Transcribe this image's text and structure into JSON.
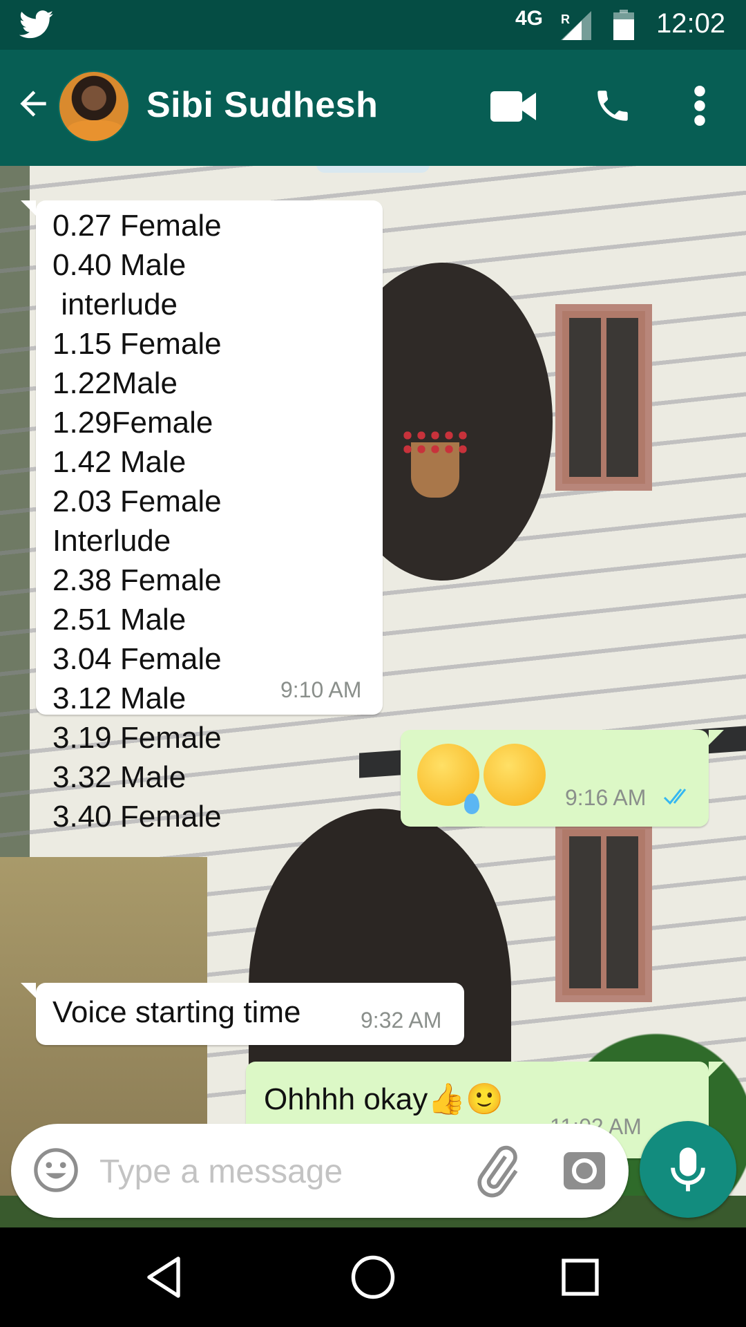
{
  "status_bar": {
    "network": "4G",
    "roaming": "R",
    "time": "12:02",
    "icons": [
      "twitter-icon",
      "signal-icon",
      "battery-icon"
    ]
  },
  "header": {
    "contact_name": "Sibi Sudhesh",
    "icons": [
      "back-arrow-icon",
      "video-call-icon",
      "phone-icon",
      "more-vert-icon"
    ]
  },
  "messages": [
    {
      "direction": "incoming",
      "text": "0.27 Female\n0.40 Male\n interlude\n1.15 Female\n1.22Male\n1.29Female\n1.42 Male\n2.03 Female\nInterlude\n2.38 Female\n2.51 Male\n3.04 Female\n3.12 Male\n3.19 Female\n3.32 Male\n3.40 Female",
      "time": "9:10 AM"
    },
    {
      "direction": "outgoing",
      "text": "😢🤔",
      "time": "9:16 AM",
      "status": "read"
    },
    {
      "direction": "incoming",
      "text": "Voice starting time",
      "time": "9:32 AM"
    },
    {
      "direction": "outgoing",
      "text": "Ohhhh okay👍🙂",
      "time": "11:02 AM",
      "status": "read"
    }
  ],
  "composer": {
    "placeholder": "Type a message",
    "icons": [
      "emoji-icon",
      "attach-icon",
      "camera-icon",
      "mic-icon"
    ]
  },
  "colors": {
    "status_bar": "#054d44",
    "app_bar": "#075e54",
    "outgoing_bubble": "#dcf8c6",
    "incoming_bubble": "#ffffff",
    "read_ticks": "#34b7f1",
    "mic_button": "#128c7e"
  }
}
